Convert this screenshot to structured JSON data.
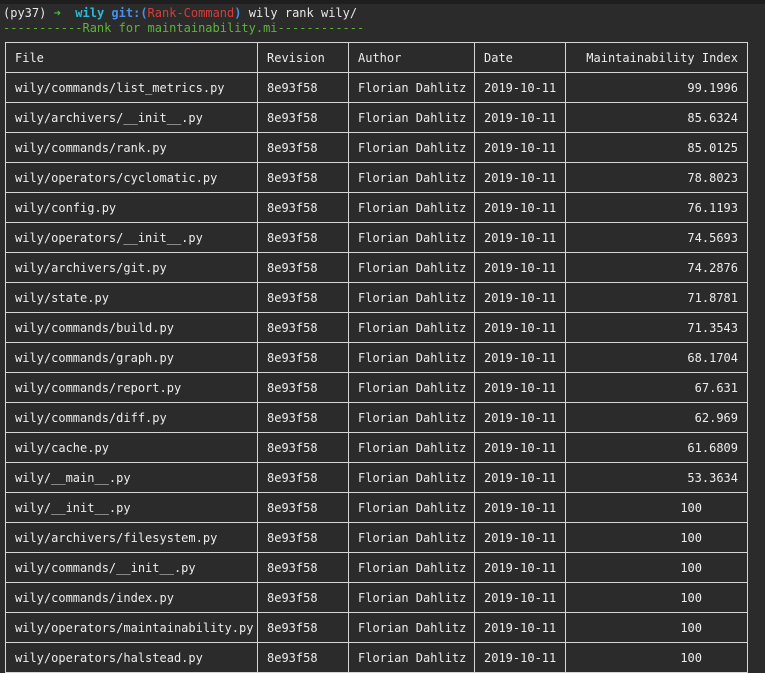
{
  "prompt": {
    "env": "(py37)",
    "arrow": "➜",
    "dir": "wily",
    "git_label": "git:(",
    "branch": "Rank-Command",
    "git_close": ")",
    "command": "wily rank wily/"
  },
  "rule_line": "-----------Rank for maintainability.mi------------",
  "table": {
    "headers": [
      "File",
      "Revision",
      "Author",
      "Date",
      "Maintainability Index"
    ],
    "rows": [
      [
        "wily/commands/list_metrics.py",
        "8e93f58",
        "Florian Dahlitz",
        "2019-10-11",
        "99.1996"
      ],
      [
        "wily/archivers/__init__.py",
        "8e93f58",
        "Florian Dahlitz",
        "2019-10-11",
        "85.6324"
      ],
      [
        "wily/commands/rank.py",
        "8e93f58",
        "Florian Dahlitz",
        "2019-10-11",
        "85.0125"
      ],
      [
        "wily/operators/cyclomatic.py",
        "8e93f58",
        "Florian Dahlitz",
        "2019-10-11",
        "78.8023"
      ],
      [
        "wily/config.py",
        "8e93f58",
        "Florian Dahlitz",
        "2019-10-11",
        "76.1193"
      ],
      [
        "wily/operators/__init__.py",
        "8e93f58",
        "Florian Dahlitz",
        "2019-10-11",
        "74.5693"
      ],
      [
        "wily/archivers/git.py",
        "8e93f58",
        "Florian Dahlitz",
        "2019-10-11",
        "74.2876"
      ],
      [
        "wily/state.py",
        "8e93f58",
        "Florian Dahlitz",
        "2019-10-11",
        "71.8781"
      ],
      [
        "wily/commands/build.py",
        "8e93f58",
        "Florian Dahlitz",
        "2019-10-11",
        "71.3543"
      ],
      [
        "wily/commands/graph.py",
        "8e93f58",
        "Florian Dahlitz",
        "2019-10-11",
        "68.1704"
      ],
      [
        "wily/commands/report.py",
        "8e93f58",
        "Florian Dahlitz",
        "2019-10-11",
        "67.631"
      ],
      [
        "wily/commands/diff.py",
        "8e93f58",
        "Florian Dahlitz",
        "2019-10-11",
        "62.969"
      ],
      [
        "wily/cache.py",
        "8e93f58",
        "Florian Dahlitz",
        "2019-10-11",
        "61.6809"
      ],
      [
        "wily/__main__.py",
        "8e93f58",
        "Florian Dahlitz",
        "2019-10-11",
        "53.3634"
      ],
      [
        "wily/__init__.py",
        "8e93f58",
        "Florian Dahlitz",
        "2019-10-11",
        "100"
      ],
      [
        "wily/archivers/filesystem.py",
        "8e93f58",
        "Florian Dahlitz",
        "2019-10-11",
        "100"
      ],
      [
        "wily/commands/__init__.py",
        "8e93f58",
        "Florian Dahlitz",
        "2019-10-11",
        "100"
      ],
      [
        "wily/commands/index.py",
        "8e93f58",
        "Florian Dahlitz",
        "2019-10-11",
        "100"
      ],
      [
        "wily/operators/maintainability.py",
        "8e93f58",
        "Florian Dahlitz",
        "2019-10-11",
        "100"
      ],
      [
        "wily/operators/halstead.py",
        "8e93f58",
        "Florian Dahlitz",
        "2019-10-11",
        "100"
      ]
    ]
  }
}
